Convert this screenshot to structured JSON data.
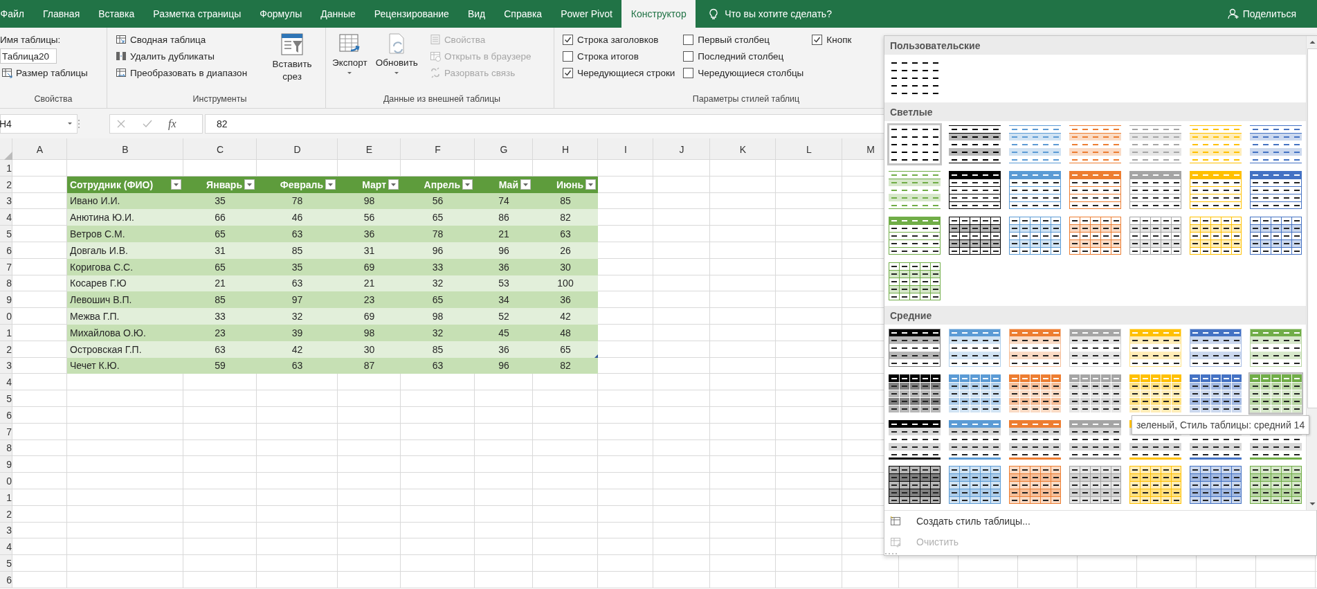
{
  "tabs": [
    {
      "label": "Файл",
      "selected": false
    },
    {
      "label": "Главная",
      "selected": false
    },
    {
      "label": "Вставка",
      "selected": false
    },
    {
      "label": "Разметка страницы",
      "selected": false
    },
    {
      "label": "Формулы",
      "selected": false
    },
    {
      "label": "Данные",
      "selected": false
    },
    {
      "label": "Рецензирование",
      "selected": false
    },
    {
      "label": "Вид",
      "selected": false
    },
    {
      "label": "Справка",
      "selected": false
    },
    {
      "label": "Power Pivot",
      "selected": false
    },
    {
      "label": "Конструктор",
      "selected": true
    }
  ],
  "tell_me": "Что вы хотите сделать?",
  "share": "Поделиться",
  "ribbon": {
    "properties": {
      "label": "Свойства",
      "name_label": "Имя таблицы:",
      "table_name": "Таблица20",
      "resize": "Размер таблицы"
    },
    "tools": {
      "label": "Инструменты",
      "buttons": [
        "Сводная таблица",
        "Удалить дубликаты",
        "Преобразовать в диапазон"
      ],
      "slicer": "Вставить срез"
    },
    "external": {
      "label": "Данные из внешней таблицы",
      "large": [
        "Экспорт",
        "Обновить"
      ],
      "small": [
        {
          "label": "Свойства",
          "disabled": true
        },
        {
          "label": "Открыть в браузере",
          "disabled": true
        },
        {
          "label": "Разорвать связь",
          "disabled": true
        }
      ]
    },
    "style_options": {
      "label": "Параметры стилей таблиц",
      "options": [
        {
          "label": "Строка заголовков",
          "checked": true
        },
        {
          "label": "Строка итогов",
          "checked": false
        },
        {
          "label": "Чередующиеся строки",
          "checked": true
        },
        {
          "label": "Первый столбец",
          "checked": false
        },
        {
          "label": "Последний столбец",
          "checked": false
        },
        {
          "label": "Чередующиеся столбцы",
          "checked": false
        },
        {
          "label": "Кнопк",
          "checked": true
        }
      ]
    }
  },
  "formula_bar": {
    "name_box": "H4",
    "function_label": "fx",
    "formula": "82"
  },
  "sheet": {
    "columns": [
      "A",
      "B",
      "C",
      "D",
      "E",
      "F",
      "G",
      "H",
      "I",
      "J",
      "K",
      "L",
      "M"
    ],
    "row_labels": [
      "1",
      "2",
      "3",
      "4",
      "5",
      "6",
      "7",
      "8",
      "9",
      "0",
      "1",
      "2",
      "3",
      "4",
      "5",
      "6",
      "7",
      "8",
      "9",
      "0",
      "1",
      "2",
      "3",
      "4",
      "5",
      "6"
    ]
  },
  "table": {
    "headers": [
      "Сотрудник (ФИО)",
      "Январь",
      "Февраль",
      "Март",
      "Апрель",
      "Май",
      "Июнь"
    ],
    "rows": [
      [
        "Ивано И.И.",
        "35",
        "78",
        "98",
        "56",
        "74",
        "85"
      ],
      [
        "Анютина Ю.И.",
        "66",
        "46",
        "56",
        "65",
        "86",
        "82"
      ],
      [
        "Ветров С.М.",
        "65",
        "63",
        "36",
        "78",
        "21",
        "63"
      ],
      [
        "Довгаль И.В.",
        "31",
        "85",
        "31",
        "96",
        "96",
        "26"
      ],
      [
        "Коригова С.С.",
        "65",
        "35",
        "69",
        "33",
        "36",
        "30"
      ],
      [
        "Косарев Г.Ю",
        "21",
        "63",
        "21",
        "32",
        "53",
        "100"
      ],
      [
        "Левошич В.П.",
        "85",
        "97",
        "23",
        "65",
        "34",
        "36"
      ],
      [
        "Межва Г.П.",
        "33",
        "32",
        "69",
        "98",
        "52",
        "42"
      ],
      [
        "Михайлова О.Ю.",
        "23",
        "39",
        "98",
        "32",
        "45",
        "48"
      ],
      [
        "Островская Г.П.",
        "63",
        "42",
        "30",
        "85",
        "36",
        "65"
      ],
      [
        "Чечет К.Ю.",
        "59",
        "63",
        "87",
        "63",
        "96",
        "82"
      ]
    ]
  },
  "gallery": {
    "sections": [
      {
        "title": "Пользовательские",
        "styles": [
          {
            "kind": "plain",
            "color": "#000000",
            "selected": false,
            "focused": false
          }
        ]
      },
      {
        "title": "Светлые",
        "styles": [
          {
            "kind": "plain",
            "color": "#000000",
            "selected": false,
            "focused": true
          },
          {
            "kind": "lines",
            "color": "#000000",
            "selected": false,
            "focused": false
          },
          {
            "kind": "lines",
            "color": "#5b9bd5",
            "selected": false,
            "focused": false
          },
          {
            "kind": "lines",
            "color": "#ed7d31",
            "selected": false,
            "focused": false
          },
          {
            "kind": "lines",
            "color": "#a5a5a5",
            "selected": false,
            "focused": false
          },
          {
            "kind": "lines",
            "color": "#ffc000",
            "selected": false,
            "focused": false
          },
          {
            "kind": "lines",
            "color": "#4472c4",
            "selected": false,
            "focused": false
          },
          {
            "kind": "lines",
            "color": "#70ad47",
            "selected": false,
            "focused": false
          },
          {
            "kind": "header",
            "color": "#000000",
            "selected": false,
            "focused": false
          },
          {
            "kind": "header",
            "color": "#5b9bd5",
            "selected": false,
            "focused": false
          },
          {
            "kind": "header",
            "color": "#ed7d31",
            "selected": false,
            "focused": false
          },
          {
            "kind": "header",
            "color": "#a5a5a5",
            "selected": false,
            "focused": false
          },
          {
            "kind": "header",
            "color": "#ffc000",
            "selected": false,
            "focused": false
          },
          {
            "kind": "header",
            "color": "#4472c4",
            "selected": false,
            "focused": false
          },
          {
            "kind": "header",
            "color": "#70ad47",
            "selected": false,
            "focused": false
          },
          {
            "kind": "grid",
            "color": "#000000",
            "selected": false,
            "focused": false
          },
          {
            "kind": "grid",
            "color": "#5b9bd5",
            "selected": false,
            "focused": false
          },
          {
            "kind": "grid",
            "color": "#ed7d31",
            "selected": false,
            "focused": false
          },
          {
            "kind": "grid",
            "color": "#a5a5a5",
            "selected": false,
            "focused": false
          },
          {
            "kind": "grid",
            "color": "#ffc000",
            "selected": false,
            "focused": false
          },
          {
            "kind": "grid",
            "color": "#4472c4",
            "selected": false,
            "focused": false
          },
          {
            "kind": "grid",
            "color": "#70ad47",
            "selected": false,
            "focused": false
          }
        ]
      },
      {
        "title": "Средние",
        "styles": [
          {
            "kind": "banded",
            "color": "#000000",
            "selected": false,
            "focused": false
          },
          {
            "kind": "banded",
            "color": "#5b9bd5",
            "selected": false,
            "focused": false
          },
          {
            "kind": "banded",
            "color": "#ed7d31",
            "selected": false,
            "focused": false
          },
          {
            "kind": "banded",
            "color": "#a5a5a5",
            "selected": false,
            "focused": false
          },
          {
            "kind": "banded",
            "color": "#ffc000",
            "selected": false,
            "focused": false
          },
          {
            "kind": "banded",
            "color": "#4472c4",
            "selected": false,
            "focused": false
          },
          {
            "kind": "banded",
            "color": "#70ad47",
            "selected": false,
            "focused": false
          },
          {
            "kind": "header-grid",
            "color": "#000000",
            "selected": false,
            "focused": false
          },
          {
            "kind": "header-grid",
            "color": "#5b9bd5",
            "selected": false,
            "focused": false
          },
          {
            "kind": "header-grid",
            "color": "#ed7d31",
            "selected": false,
            "focused": false
          },
          {
            "kind": "header-grid",
            "color": "#a5a5a5",
            "selected": false,
            "focused": false
          },
          {
            "kind": "header-grid",
            "color": "#ffc000",
            "selected": false,
            "focused": false
          },
          {
            "kind": "header-grid",
            "color": "#4472c4",
            "selected": false,
            "focused": false
          },
          {
            "kind": "header-grid",
            "color": "#70ad47",
            "selected": true,
            "focused": false
          },
          {
            "kind": "header-lines",
            "color": "#000000",
            "selected": false,
            "focused": false
          },
          {
            "kind": "header-lines",
            "color": "#5b9bd5",
            "selected": false,
            "focused": false
          },
          {
            "kind": "header-lines",
            "color": "#ed7d31",
            "selected": false,
            "focused": false
          },
          {
            "kind": "header-lines",
            "color": "#a5a5a5",
            "selected": false,
            "focused": false
          },
          {
            "kind": "header-lines",
            "color": "#ffc000",
            "selected": false,
            "focused": false
          },
          {
            "kind": "header-lines",
            "color": "#4472c4",
            "selected": false,
            "focused": false
          },
          {
            "kind": "header-lines",
            "color": "#70ad47",
            "selected": false,
            "focused": false
          },
          {
            "kind": "tint-grid",
            "color": "#000000",
            "selected": false,
            "focused": false
          },
          {
            "kind": "tint-grid",
            "color": "#5b9bd5",
            "selected": false,
            "focused": false
          },
          {
            "kind": "tint-grid",
            "color": "#ed7d31",
            "selected": false,
            "focused": false
          },
          {
            "kind": "tint-grid",
            "color": "#a5a5a5",
            "selected": false,
            "focused": false
          },
          {
            "kind": "tint-grid",
            "color": "#ffc000",
            "selected": false,
            "focused": false
          },
          {
            "kind": "tint-grid",
            "color": "#4472c4",
            "selected": false,
            "focused": false
          },
          {
            "kind": "tint-grid",
            "color": "#70ad47",
            "selected": false,
            "focused": false
          }
        ]
      }
    ],
    "commands": [
      {
        "label": "Создать стиль таблицы...",
        "disabled": false
      },
      {
        "label": "Очистить",
        "disabled": true
      }
    ],
    "tooltip": "зеленый, Стиль таблицы: средний 14"
  }
}
